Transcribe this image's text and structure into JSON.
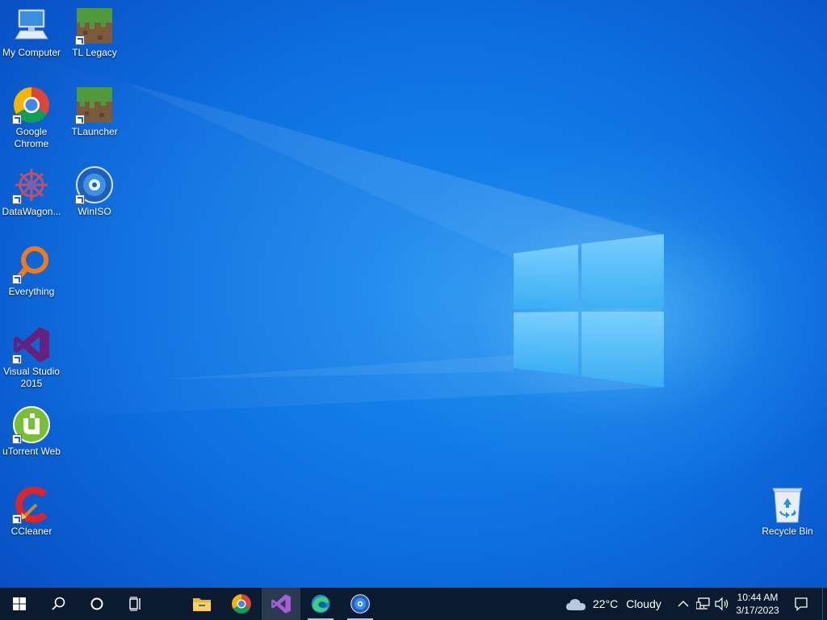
{
  "desktop": {
    "icons": [
      {
        "id": "my-computer",
        "label": "My Computer",
        "icon": "computer-icon"
      },
      {
        "id": "tl-legacy",
        "label": "TL Legacy",
        "icon": "grass-block-icon"
      },
      {
        "id": "google-chrome",
        "label": "Google Chrome",
        "icon": "chrome-icon"
      },
      {
        "id": "tlauncher",
        "label": "TLauncher",
        "icon": "grass-block-icon"
      },
      {
        "id": "datawagon",
        "label": "DataWagon...",
        "icon": "datawagon-icon"
      },
      {
        "id": "winiso",
        "label": "WinISO",
        "icon": "disc-icon"
      },
      {
        "id": "everything",
        "label": "Everything",
        "icon": "magnifier-icon"
      },
      {
        "id": "visual-studio",
        "label": "Visual Studio 2015",
        "icon": "visual-studio-icon"
      },
      {
        "id": "utorrent-web",
        "label": "uTorrent Web",
        "icon": "utorrent-icon"
      },
      {
        "id": "ccleaner",
        "label": "CCleaner",
        "icon": "ccleaner-icon"
      },
      {
        "id": "recycle-bin",
        "label": "Recycle Bin",
        "icon": "recycle-bin-icon"
      }
    ]
  },
  "taskbar": {
    "start_icon": "windows-logo-icon",
    "search_icon": "search-icon",
    "cortana_icon": "cortana-icon",
    "task_view_icon": "task-view-icon",
    "pinned_apps": [
      {
        "name": "File Explorer",
        "icon": "file-explorer-icon",
        "active": false
      },
      {
        "name": "Google Chrome",
        "icon": "chrome-icon",
        "active": false
      },
      {
        "name": "Visual Studio 2015",
        "icon": "visual-studio-icon",
        "active": true
      },
      {
        "name": "Microsoft Edge",
        "icon": "edge-icon",
        "active": false,
        "running": true
      },
      {
        "name": "WinISO",
        "icon": "disc-icon",
        "active": false,
        "running": true
      }
    ],
    "weather": {
      "icon": "cloud-icon",
      "temperature": "22°C",
      "condition": "Cloudy"
    },
    "tray": {
      "chevron_icon": "chevron-up-icon",
      "network_icon": "network-icon",
      "volume_icon": "volume-icon",
      "notification_icon": "notification-icon"
    },
    "clock": {
      "time": "10:44 AM",
      "date": "3/17/2023"
    }
  },
  "colors": {
    "taskbar_bg": "#0b1a2e",
    "desktop_accent": "#0d6fe0"
  }
}
